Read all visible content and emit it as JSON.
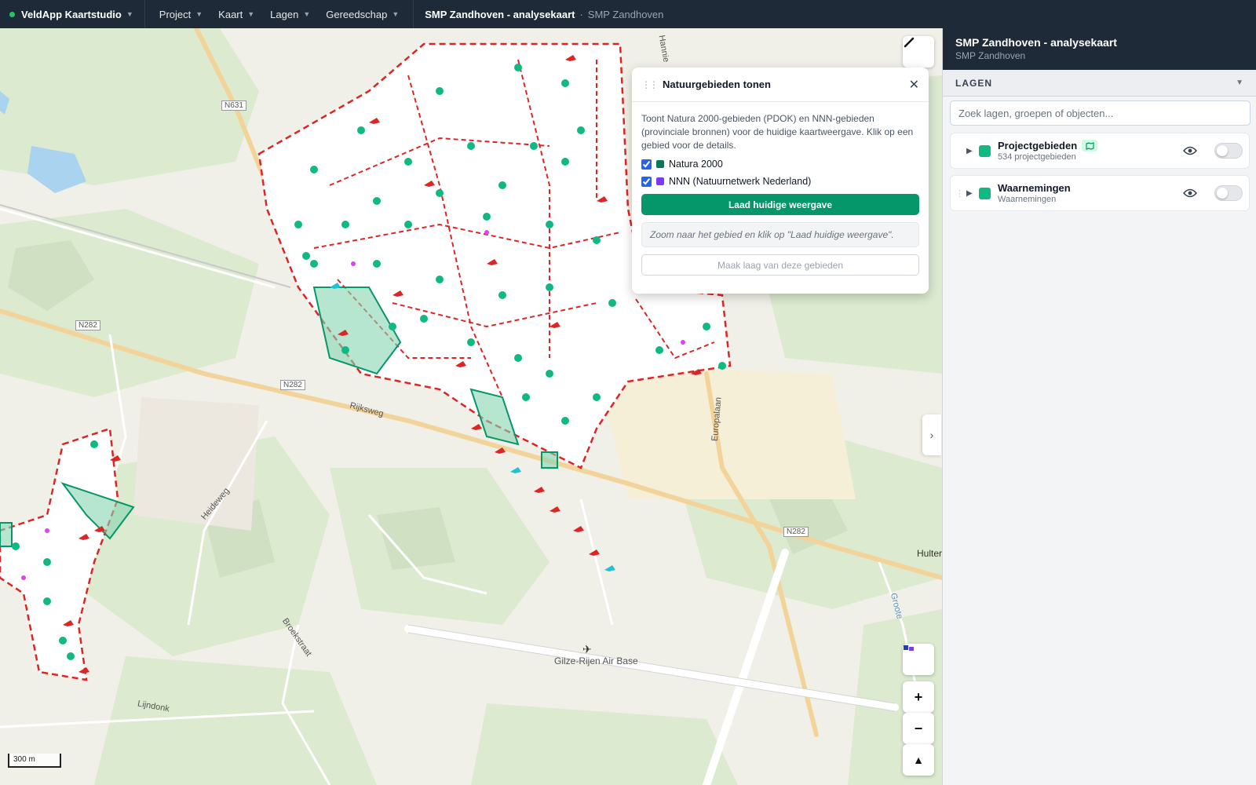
{
  "app": {
    "name": "VeldApp Kaartstudio"
  },
  "menu": [
    {
      "label": "Project"
    },
    {
      "label": "Kaart"
    },
    {
      "label": "Lagen"
    },
    {
      "label": "Gereedschap"
    }
  ],
  "breadcrumb": {
    "title": "SMP Zandhoven - analysekaart",
    "separator": "·",
    "subtitle": "SMP Zandhoven"
  },
  "map": {
    "road_labels": [
      "N631",
      "N282",
      "N282",
      "N282",
      "Rijksweg",
      "Heideweg",
      "Broekstraat",
      "Lijndonk",
      "Europalaan",
      "Hannie",
      "Groote",
      "Hulter"
    ],
    "airbase_label": "Gilze-Rijen Air Base",
    "scale_label": "300 m"
  },
  "popup": {
    "title": "Natuurgebieden tonen",
    "description": "Toont Natura 2000-gebieden (PDOK) en NNN-gebieden (provinciale bronnen) voor de huidige kaartweergave. Klik op een gebied voor de details.",
    "options": [
      {
        "label": "Natura 2000",
        "checked": true,
        "color": "#047857"
      },
      {
        "label": "NNN (Natuurnetwerk Nederland)",
        "checked": true,
        "color": "#7c3aed"
      }
    ],
    "load_button": "Laad huidige weergave",
    "hint": "Zoom naar het gebied en klik op \"Laad huidige weergave\".",
    "make_layer_button": "Maak laag van deze gebieden"
  },
  "sidebar": {
    "title": "SMP Zandhoven - analysekaart",
    "subtitle": "SMP Zandhoven",
    "section_label": "LAGEN",
    "search_placeholder": "Zoek lagen, groepen of objecten...",
    "layers": [
      {
        "name": "Projectgebieden",
        "count": "534 projectgebieden",
        "color": "#10b981",
        "visible": false
      },
      {
        "name": "Waarnemingen",
        "count": "Waarnemingen",
        "color": "#10b981",
        "visible": false
      }
    ]
  },
  "colors": {
    "topbar": "#1e2a38",
    "accent": "#059669",
    "project_outline": "#dc2626",
    "natura": "#10b981"
  }
}
